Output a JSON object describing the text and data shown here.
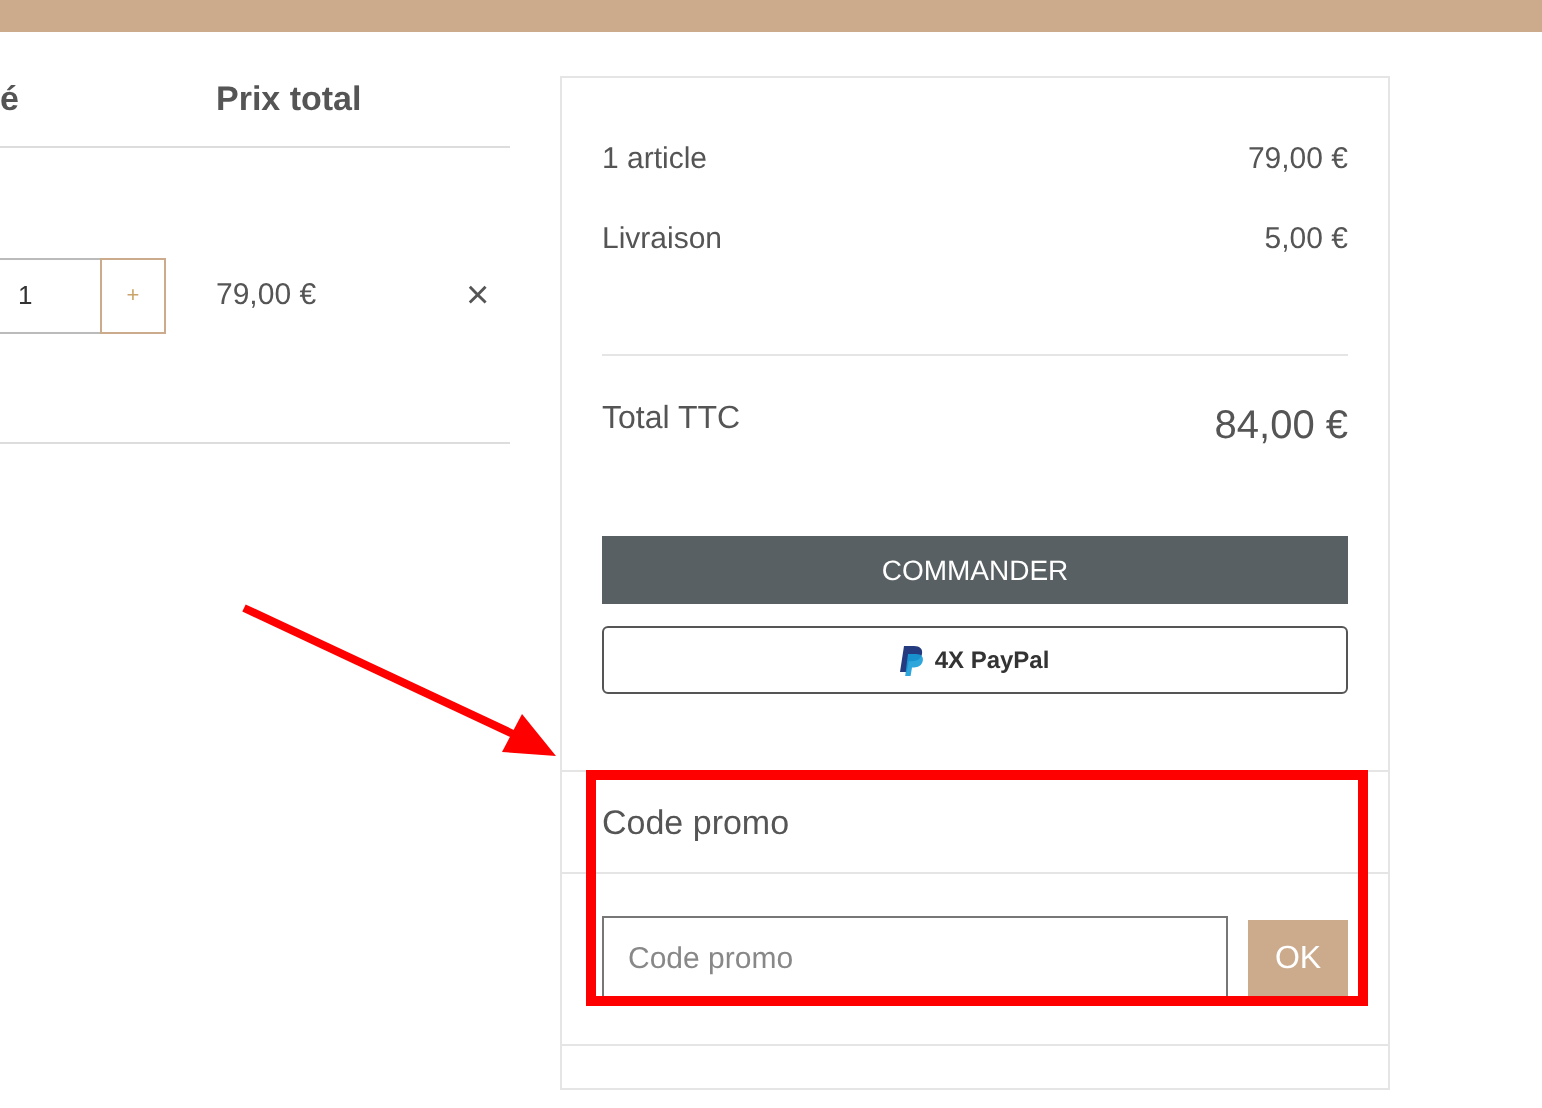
{
  "cart": {
    "columns": [
      "é",
      "Prix total"
    ],
    "items": [
      {
        "quantity": "1",
        "increment": "+",
        "total": "79,00 €",
        "remove": "×"
      }
    ]
  },
  "summary": {
    "lines": [
      {
        "label": "1 article",
        "value": "79,00 €"
      },
      {
        "label": "Livraison",
        "value": "5,00 €"
      }
    ],
    "total": {
      "label": "Total TTC",
      "value": "84,00 €"
    },
    "checkout_button": "COMMANDER",
    "paypal_button": "4X PayPal"
  },
  "promo": {
    "title": "Code promo",
    "placeholder": "Code promo",
    "submit": "OK"
  }
}
